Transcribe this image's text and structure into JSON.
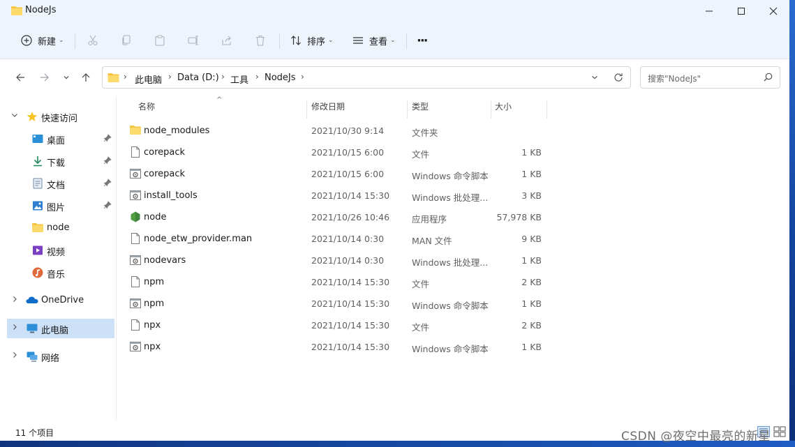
{
  "window": {
    "title": "NodeJs"
  },
  "toolbar": {
    "new_label": "新建",
    "sort_label": "排序",
    "view_label": "查看",
    "more_label": "···"
  },
  "address": {
    "crumbs": [
      "此电脑",
      "Data (D:)",
      "工具",
      "NodeJs"
    ],
    "search_placeholder": "搜索\"NodeJs\""
  },
  "sidebar": {
    "items": [
      {
        "label": "快速访问",
        "icon": "star-icon"
      },
      {
        "label": "桌面",
        "icon": "desktop-icon"
      },
      {
        "label": "下载",
        "icon": "download-icon"
      },
      {
        "label": "文档",
        "icon": "document-icon"
      },
      {
        "label": "图片",
        "icon": "picture-icon"
      },
      {
        "label": "node",
        "icon": "folder-icon"
      },
      {
        "label": "视频",
        "icon": "video-icon"
      },
      {
        "label": "音乐",
        "icon": "music-icon"
      },
      {
        "label": "OneDrive",
        "icon": "cloud-icon"
      },
      {
        "label": "此电脑",
        "icon": "computer-icon"
      },
      {
        "label": "网络",
        "icon": "network-icon"
      }
    ]
  },
  "columns": {
    "name": "名称",
    "date": "修改日期",
    "type": "类型",
    "size": "大小"
  },
  "files": [
    {
      "name": "node_modules",
      "date": "2021/10/30 9:14",
      "type": "文件夹",
      "size": "",
      "icon": "folder-icon"
    },
    {
      "name": "corepack",
      "date": "2021/10/15 6:00",
      "type": "文件",
      "size": "1 KB",
      "icon": "file-icon"
    },
    {
      "name": "corepack",
      "date": "2021/10/15 6:00",
      "type": "Windows 命令脚本",
      "size": "1 KB",
      "icon": "script-icon"
    },
    {
      "name": "install_tools",
      "date": "2021/10/14 15:30",
      "type": "Windows 批处理...",
      "size": "3 KB",
      "icon": "script-icon"
    },
    {
      "name": "node",
      "date": "2021/10/26 10:46",
      "type": "应用程序",
      "size": "57,978 KB",
      "icon": "nodejs-icon"
    },
    {
      "name": "node_etw_provider.man",
      "date": "2021/10/14 0:30",
      "type": "MAN 文件",
      "size": "9 KB",
      "icon": "file-icon"
    },
    {
      "name": "nodevars",
      "date": "2021/10/14 0:30",
      "type": "Windows 批处理...",
      "size": "1 KB",
      "icon": "script-icon"
    },
    {
      "name": "npm",
      "date": "2021/10/14 15:30",
      "type": "文件",
      "size": "2 KB",
      "icon": "file-icon"
    },
    {
      "name": "npm",
      "date": "2021/10/14 15:30",
      "type": "Windows 命令脚本",
      "size": "1 KB",
      "icon": "script-icon"
    },
    {
      "name": "npx",
      "date": "2021/10/14 15:30",
      "type": "文件",
      "size": "2 KB",
      "icon": "file-icon"
    },
    {
      "name": "npx",
      "date": "2021/10/14 15:30",
      "type": "Windows 命令脚本",
      "size": "1 KB",
      "icon": "script-icon"
    }
  ],
  "status": {
    "count": "11 个项目"
  },
  "watermark": "CSDN @夜空中最亮的新星",
  "colors": {
    "titlebar": "#eef4fb",
    "selected": "#cce1f7",
    "folder": "#f5c542",
    "nodejs": "#539e43"
  }
}
